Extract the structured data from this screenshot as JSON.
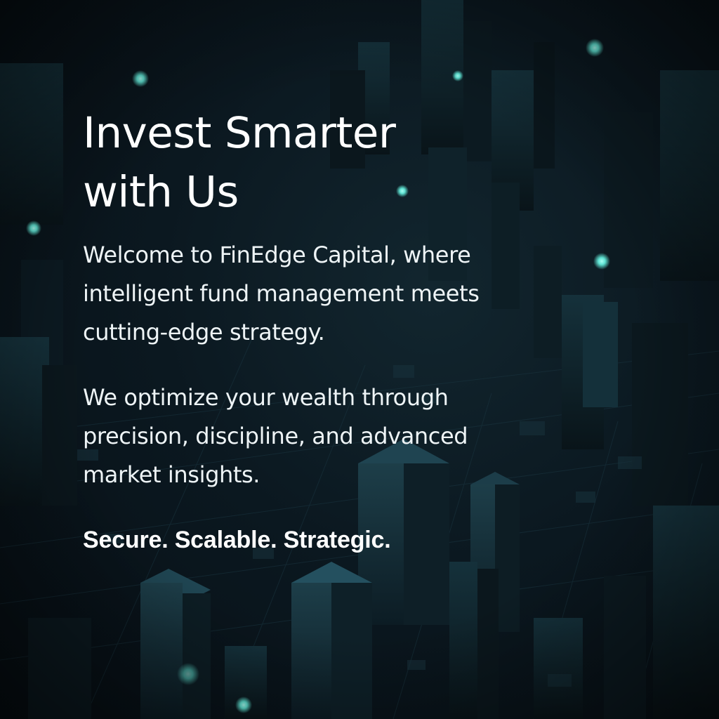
{
  "hero": {
    "headline": "Invest Smarter with Us",
    "paragraph_1": "Welcome to FinEdge Capital, where intelligent fund management meets cutting-edge strategy.",
    "paragraph_2": "We optimize your wealth through precision, discipline, and advanced market insights.",
    "tagline": "Secure. Scalable. Strategic."
  },
  "theme": {
    "background": "#0b1820",
    "building_face": "#12303a",
    "glow": "#6ff0e0",
    "text": "#ffffff"
  }
}
